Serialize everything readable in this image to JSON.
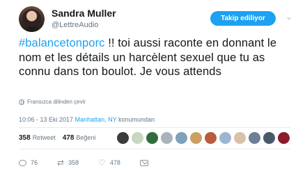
{
  "author": {
    "name": "Sandra Muller",
    "handle": "@LettreAudio"
  },
  "follow_button_label": "Takip ediliyor",
  "tweet": {
    "hashtag": "#balancetonporc",
    "body": " !!  toi aussi raconte en donnant le nom et les détails un harcèlent sexuel que tu as connu dans ton boulot. Je vous attends",
    "translate_label": "Fransızca dilinden çevir",
    "timestamp": "10:06 - 13 Eki 2017",
    "location": "Manhattan, NY",
    "location_suffix": "konumundan"
  },
  "stats": {
    "retweets_count": "358",
    "retweets_label": "Retweet",
    "likes_count": "478",
    "likes_label": "Beğeni"
  },
  "likers_colors": [
    "#3b3b3b",
    "#c9d6c2",
    "#2f6d3a",
    "#a9b2bd",
    "#7fa1b9",
    "#c8a062",
    "#b95b3c",
    "#9cb6d0",
    "#d8c1a8",
    "#6e7f94",
    "#4a5a6a",
    "#8b1c2c"
  ],
  "actions": {
    "replies": "76",
    "retweets": "358",
    "likes": "478"
  },
  "colors": {
    "accent": "#1da1f2",
    "muted": "#657786"
  }
}
